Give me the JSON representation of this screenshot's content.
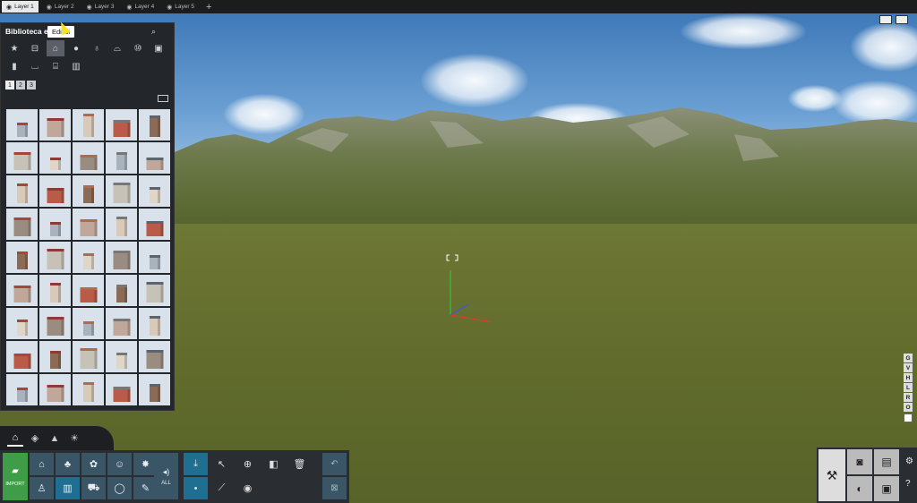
{
  "layer_tabs": [
    {
      "label": "Layer 1",
      "active": true
    },
    {
      "label": "Layer 2",
      "active": false
    },
    {
      "label": "Layer 3",
      "active": false
    },
    {
      "label": "Layer 4",
      "active": false
    },
    {
      "label": "Layer 5",
      "active": false
    }
  ],
  "add_layer": "+",
  "library": {
    "title": "Biblioteca e",
    "tooltip": "Edifici",
    "pages": [
      "1",
      "2",
      "3"
    ],
    "categories_row1": [
      "star-icon",
      "bench-icon",
      "building-icon",
      "sphere-icon",
      "lamp-icon",
      "hill-icon",
      "10-icon",
      "cube-icon"
    ],
    "categories_row2": [
      "bin-icon",
      "boat-icon",
      "factory-icon",
      "fence-icon"
    ]
  },
  "bottom": {
    "import_label": "IMPORT",
    "all_label": "ALL"
  },
  "side_buttons": [
    "G",
    "V",
    "H",
    "L",
    "R",
    "O"
  ],
  "colors": {
    "import_green": "#3f9d48",
    "active_blue": "#1f6f92",
    "tool_blue": "#3a5566"
  }
}
